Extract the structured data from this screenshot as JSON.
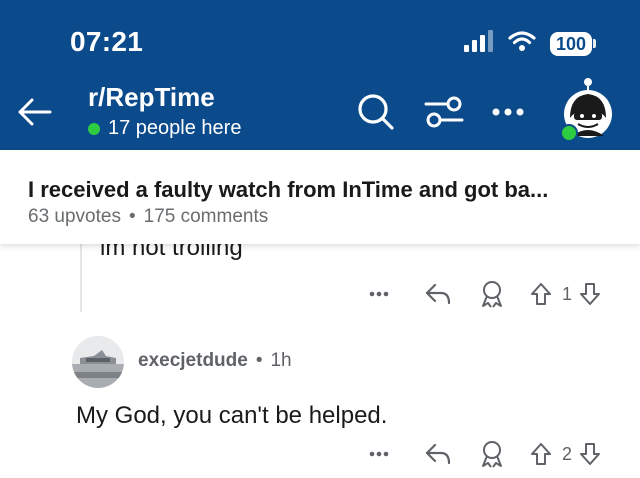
{
  "status_bar": {
    "time": "07:21",
    "battery": "100"
  },
  "header": {
    "subreddit": "r/RepTime",
    "presence": "17 people here"
  },
  "post": {
    "title": "I received a faulty watch from InTime and got ba...",
    "upvotes": "63 upvotes",
    "separator": "•",
    "comments": "175 comments"
  },
  "comment_prev": {
    "partial_text": "im not trolling",
    "upvote_count": "1"
  },
  "comment": {
    "author": "execjetdude",
    "separator": "•",
    "age": "1h",
    "body": "My God, you can't be helped.",
    "upvote_count": "2"
  },
  "colors": {
    "brand_blue": "#0b4a8b",
    "online_green": "#2ecc40"
  },
  "icons": [
    "back-arrow-icon",
    "search-icon",
    "filter-icon",
    "more-icon",
    "reply-icon",
    "award-icon",
    "upvote-icon",
    "downvote-icon"
  ]
}
